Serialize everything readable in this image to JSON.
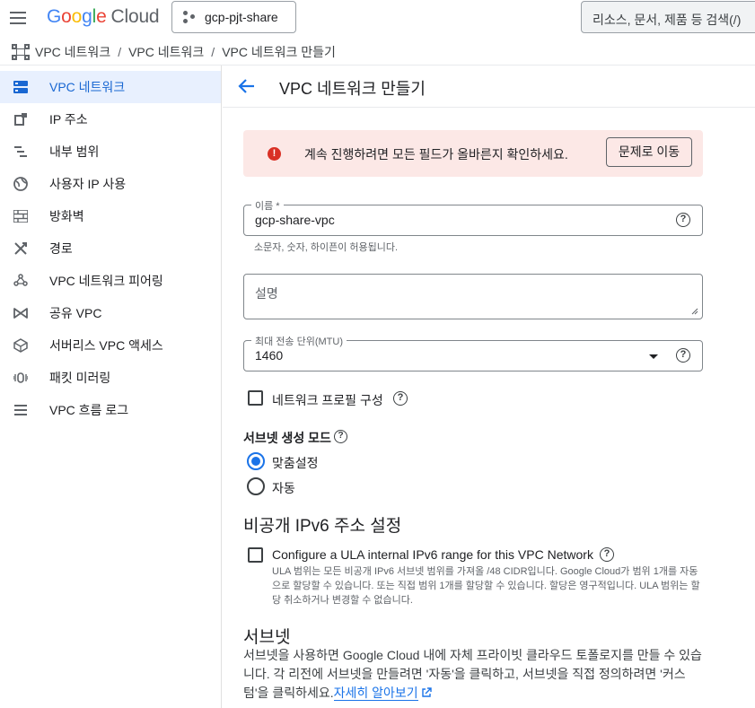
{
  "header": {
    "logo_google_letters": [
      "G",
      "o",
      "o",
      "g",
      "l",
      "e"
    ],
    "logo_cloud": "Cloud",
    "project_name": "gcp-pjt-share",
    "search_placeholder": "리소스, 문서, 제품 등 검색(/)"
  },
  "breadcrumb": {
    "items": [
      "VPC 네트워크",
      "VPC 네트워크",
      "VPC 네트워크 만들기"
    ],
    "separator": "/"
  },
  "sidebar": {
    "items": [
      {
        "label": "VPC 네트워크",
        "icon": "vpc-network-icon",
        "active": true
      },
      {
        "label": "IP 주소",
        "icon": "ip-address-icon",
        "active": false
      },
      {
        "label": "내부 범위",
        "icon": "internal-range-icon",
        "active": false
      },
      {
        "label": "사용자 IP 사용",
        "icon": "globe-icon",
        "active": false
      },
      {
        "label": "방화벽",
        "icon": "firewall-icon",
        "active": false
      },
      {
        "label": "경로",
        "icon": "route-icon",
        "active": false
      },
      {
        "label": "VPC 네트워크 피어링",
        "icon": "peering-icon",
        "active": false
      },
      {
        "label": "공유 VPC",
        "icon": "shared-vpc-icon",
        "active": false
      },
      {
        "label": "서버리스 VPC 액세스",
        "icon": "serverless-icon",
        "active": false
      },
      {
        "label": "패킷 미러링",
        "icon": "packet-mirroring-icon",
        "active": false
      },
      {
        "label": "VPC 흐름 로그",
        "icon": "flow-logs-icon",
        "active": false
      }
    ]
  },
  "main": {
    "title": "VPC 네트워크 만들기",
    "error": {
      "message": "계속 진행하려면 모든 필드가 올바른지 확인하세요.",
      "button": "문제로 이동"
    },
    "name_field": {
      "label": "이름 *",
      "value": "gcp-share-vpc",
      "hint": "소문자, 숫자, 하이픈이 허용됩니다."
    },
    "description_field": {
      "placeholder": "설명"
    },
    "mtu_field": {
      "label": "최대 전송 단위(MTU)",
      "value": "1460"
    },
    "network_profile_checkbox": {
      "label": "네트워크 프로필 구성",
      "checked": false
    },
    "subnet_mode": {
      "label": "서브넷 생성 모드",
      "options": [
        "맞춤설정",
        "자동"
      ],
      "selected": "맞춤설정"
    },
    "ipv6_section": {
      "title": "비공개 IPv6 주소 설정",
      "checkbox_label": "Configure a ULA internal IPv6 range for this VPC Network",
      "checked": false,
      "description": "ULA 범위는 모든 비공개 IPv6 서브넷 범위를 가져올 /48 CIDR입니다. Google Cloud가 범위 1개를 자동으로 할당할 수 있습니다. 또는 직접 범위 1개를 할당할 수 있습니다. 할당은 영구적입니다. ULA 범위는 할당 취소하거나 변경할 수 없습니다."
    },
    "subnet_section": {
      "title": "서브넷",
      "description": "서브넷을 사용하면 Google Cloud 내에 자체 프라이빗 클라우드 토폴로지를 만들 수 있습니다. 각 리전에 서브넷을 만들려면 '자동'을 클릭하고, 서브넷을 직접 정의하려면 '커스텀'을 클릭하세요.",
      "link": "자세히 알아보기"
    }
  },
  "colors": {
    "accent": "#1a73e8",
    "active_bg": "#e8f0fe",
    "error_bg": "#fce8e6",
    "error_icon": "#d93025"
  }
}
